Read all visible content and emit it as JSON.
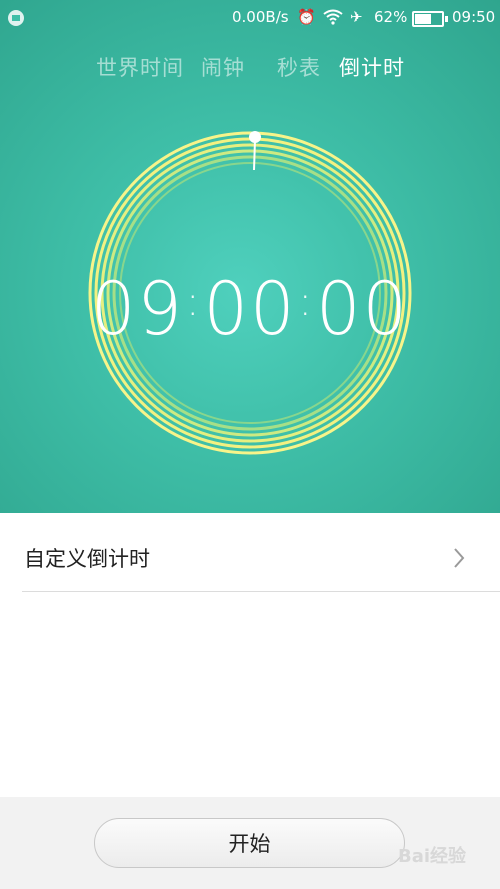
{
  "status_bar": {
    "net_speed": "0.00B/s",
    "battery_percent": "62%",
    "time": "09:50",
    "icons": [
      "notification-icon",
      "alarm-icon",
      "wifi-icon",
      "airplane-icon",
      "battery-icon"
    ]
  },
  "tabs": [
    {
      "label": "世界时间",
      "active": false
    },
    {
      "label": "闹钟",
      "active": false
    },
    {
      "label": "秒表",
      "active": false
    },
    {
      "label": "倒计时",
      "active": true
    }
  ],
  "timer": {
    "hours": "09",
    "minutes": "00",
    "seconds": "00"
  },
  "custom_row": {
    "label": "自定义倒计时"
  },
  "start_button": {
    "label": "开始"
  },
  "watermark": {
    "text": "Bai经验"
  },
  "colors": {
    "accent": "#3fbfa8",
    "ring_outer": "#f7f48a",
    "ring_inner": "#9fe08a"
  }
}
